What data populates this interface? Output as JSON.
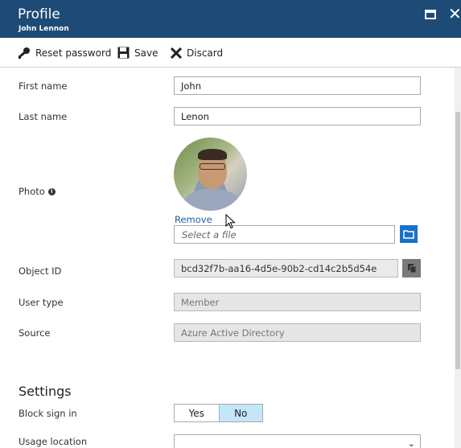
{
  "header": {
    "title": "Profile",
    "subtitle": "John Lennon",
    "background": "#1e4a76"
  },
  "toolbar": {
    "reset_password": "Reset password",
    "save": "Save",
    "discard": "Discard"
  },
  "fields": {
    "first_name": {
      "label": "First name",
      "value": "John"
    },
    "last_name": {
      "label": "Last name",
      "value": "Lenon"
    },
    "photo": {
      "label": "Photo",
      "remove_label": "Remove",
      "file_placeholder": "Select a file"
    },
    "object_id": {
      "label": "Object ID",
      "value": "bcd32f7b-aa16-4d5e-90b2-cd14c2b5d54e"
    },
    "user_type": {
      "label": "User type",
      "value": "Member"
    },
    "source": {
      "label": "Source",
      "value": "Azure Active Directory"
    }
  },
  "settings": {
    "title": "Settings",
    "block_sign_in": {
      "label": "Block sign in",
      "options": [
        "Yes",
        "No"
      ],
      "selected": "No"
    },
    "usage_location": {
      "label": "Usage location",
      "value": ""
    }
  },
  "colors": {
    "accent": "#1672c9",
    "link": "#1e5fa8",
    "toggle_selected": "#c3e6f8"
  }
}
